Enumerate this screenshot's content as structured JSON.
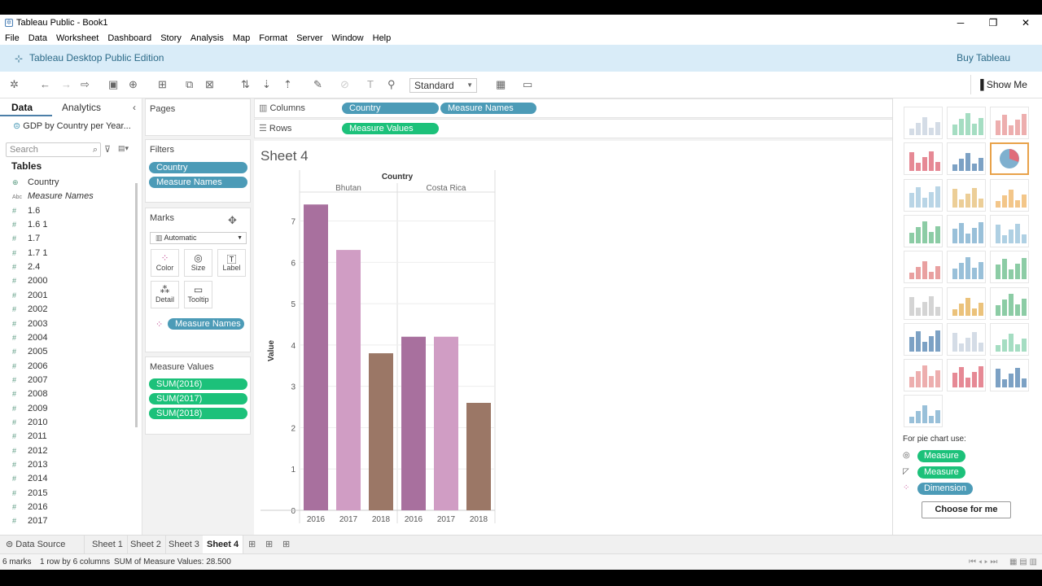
{
  "window": {
    "title": "Tableau Public - Book1",
    "min": "─",
    "restore": "❐",
    "close": "✕"
  },
  "menu": [
    "File",
    "Data",
    "Worksheet",
    "Dashboard",
    "Story",
    "Analysis",
    "Map",
    "Format",
    "Server",
    "Window",
    "Help"
  ],
  "banner": {
    "edition": "Tableau Desktop Public Edition",
    "buy": "Buy Tableau"
  },
  "toolbar": {
    "fit": "Standard",
    "show_me": "Show Me"
  },
  "data_pane": {
    "tab_data": "Data",
    "tab_analytics": "Analytics",
    "datasource": "GDP by Country per Year...",
    "search_placeholder": "Search",
    "tables_label": "Tables",
    "fields": [
      "Country",
      "Measure Names",
      "1.6",
      "1.6 1",
      "1.7",
      "1.7 1",
      "2.4",
      "2000",
      "2001",
      "2002",
      "2003",
      "2004",
      "2005",
      "2006",
      "2007",
      "2008",
      "2009",
      "2010",
      "2011",
      "2012",
      "2013",
      "2014",
      "2015",
      "2016",
      "2017"
    ]
  },
  "pages": {
    "label": "Pages"
  },
  "filters": {
    "label": "Filters",
    "pills": [
      "Country",
      "Measure Names"
    ]
  },
  "marks": {
    "label": "Marks",
    "type": "Automatic",
    "buttons": [
      "Color",
      "Size",
      "Label",
      "Detail",
      "Tooltip"
    ],
    "color_pill": "Measure Names"
  },
  "measure_values": {
    "label": "Measure Values",
    "pills": [
      "SUM(2016)",
      "SUM(2017)",
      "SUM(2018)"
    ]
  },
  "shelves": {
    "columns_label": "Columns",
    "rows_label": "Rows",
    "columns": [
      "Country",
      "Measure Names"
    ],
    "rows": [
      "Measure Values"
    ]
  },
  "sheet": {
    "title": "Sheet 4"
  },
  "chart_data": {
    "type": "bar",
    "column_header": "Country",
    "panes": [
      "Bhutan",
      "Costa Rica"
    ],
    "categories": [
      "2016",
      "2017",
      "2018"
    ],
    "ylabel": "Value",
    "ylim": [
      0,
      7.7
    ],
    "yticks": [
      0,
      1,
      2,
      3,
      4,
      5,
      6,
      7
    ],
    "colors": [
      "#a8709e",
      "#d09dc4",
      "#9b7766"
    ],
    "series": [
      {
        "pane": "Bhutan",
        "values": [
          7.4,
          6.3,
          3.8
        ]
      },
      {
        "pane": "Costa Rica",
        "values": [
          4.2,
          4.2,
          2.6
        ]
      }
    ],
    "grid": true
  },
  "show_me": {
    "hint": "For pie chart use:",
    "requirements": [
      {
        "label": "Measure",
        "color": "#1cc17a"
      },
      {
        "label": "Measure",
        "color": "#1cc17a"
      },
      {
        "label": "Dimension",
        "color": "#4c9bb7"
      }
    ],
    "choose": "Choose for me"
  },
  "tabs": {
    "data_source": "Data Source",
    "sheets": [
      "Sheet 1",
      "Sheet 2",
      "Sheet 3",
      "Sheet 4"
    ],
    "active": "Sheet 4"
  },
  "status": {
    "marks": "6 marks",
    "rows": "1 row by 6 columns",
    "sum": "SUM of Measure Values: 28.500"
  }
}
